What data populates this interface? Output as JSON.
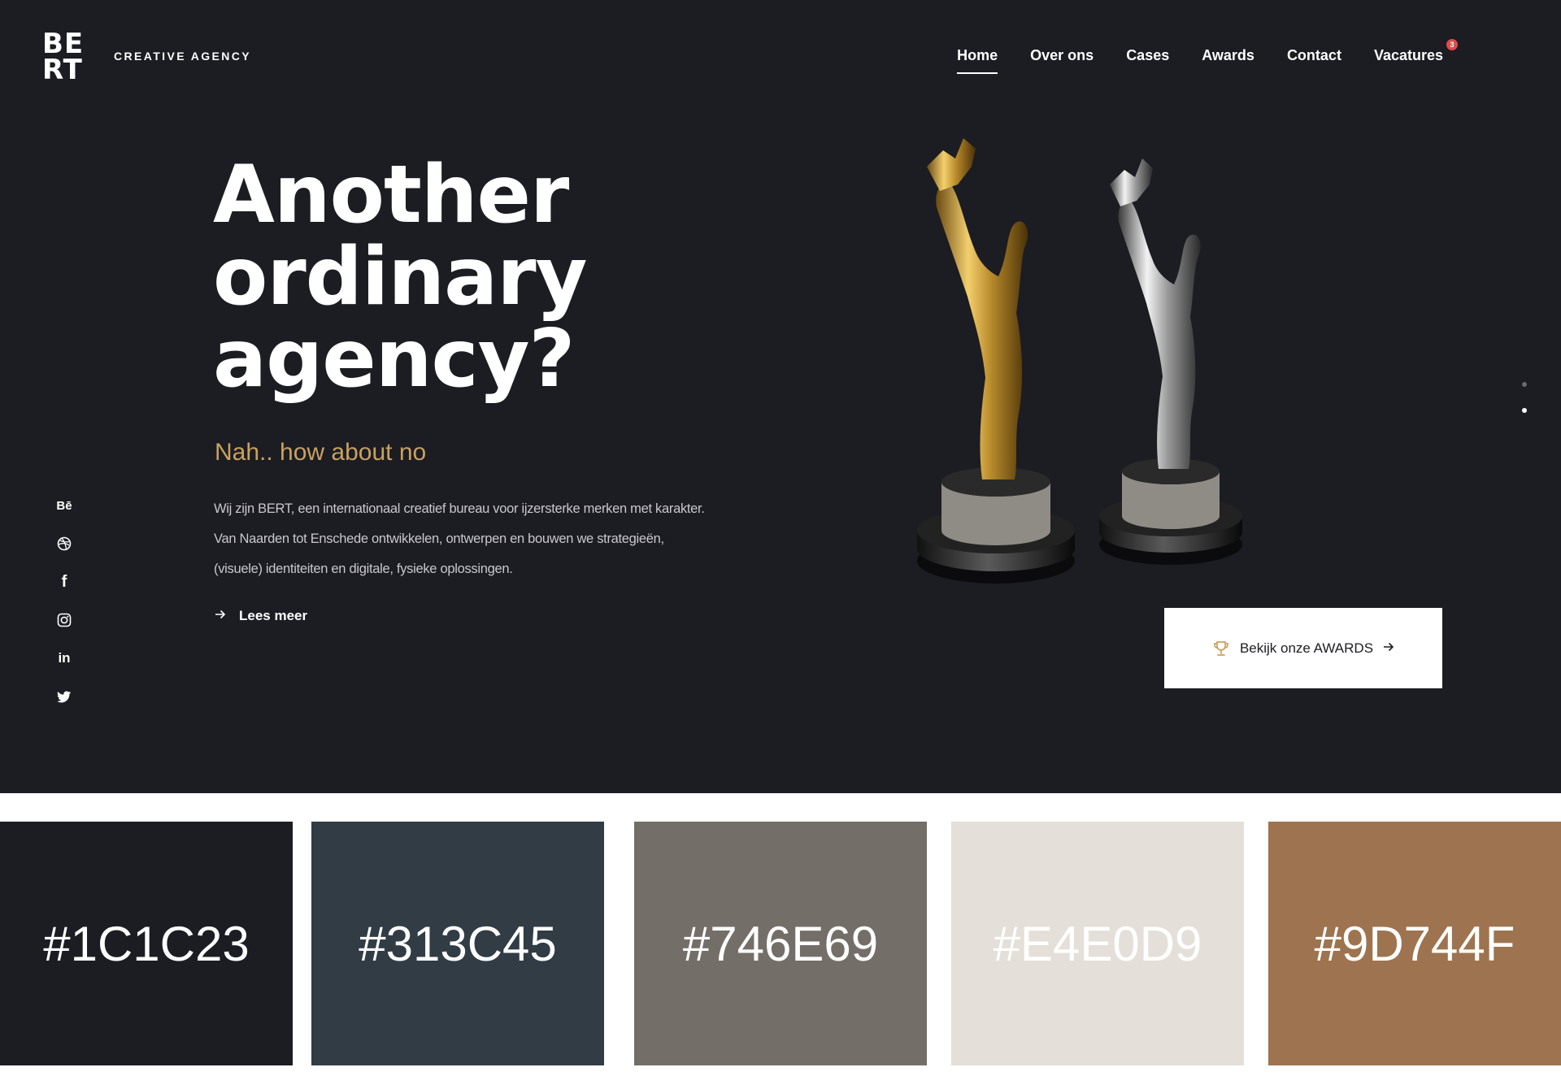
{
  "header": {
    "logo_top": "BE",
    "logo_bottom": "RT",
    "tagline": "CREATIVE AGENCY",
    "nav": [
      {
        "label": "Home",
        "active": true
      },
      {
        "label": "Over ons",
        "active": false
      },
      {
        "label": "Cases",
        "active": false
      },
      {
        "label": "Awards",
        "active": false
      },
      {
        "label": "Contact",
        "active": false
      },
      {
        "label": "Vacatures",
        "active": false,
        "badge": "3"
      }
    ]
  },
  "hero": {
    "headline_lines": [
      "Another",
      "ordinary",
      "agency?"
    ],
    "subhead": "Nah.. how about no",
    "description_lines": [
      "Wij zijn BERT, een internationaal creatief bureau voor ijzersterke merken met karakter.",
      "Van Naarden tot Enschede ontwikkelen, ontwerpen en bouwen we strategieën,",
      "(visuele) identiteiten en digitale, fysieke oplossingen."
    ],
    "read_more_label": "Lees meer",
    "awards_button_label": "Bekijk onze AWARDS"
  },
  "social": [
    {
      "name": "behance",
      "glyph": "Bē"
    },
    {
      "name": "dribbble",
      "glyph": ""
    },
    {
      "name": "facebook",
      "glyph": "f"
    },
    {
      "name": "instagram",
      "glyph": ""
    },
    {
      "name": "linkedin",
      "glyph": "in"
    },
    {
      "name": "twitter",
      "glyph": ""
    }
  ],
  "slider": {
    "count": 2,
    "active_index": 1
  },
  "swatches": [
    {
      "label": "#1C1C23",
      "color": "#1C1C23"
    },
    {
      "label": "#313C45",
      "color": "#313C45"
    },
    {
      "label": "#746E69",
      "color": "#746E69"
    },
    {
      "label": "#E4E0D9",
      "color": "#E4E0D9"
    },
    {
      "label": "#9D744F",
      "color": "#9D744F"
    }
  ],
  "colors": {
    "background": "#1C1C23",
    "accent_gold": "#C9A15F",
    "badge_red": "#E04B4B"
  }
}
